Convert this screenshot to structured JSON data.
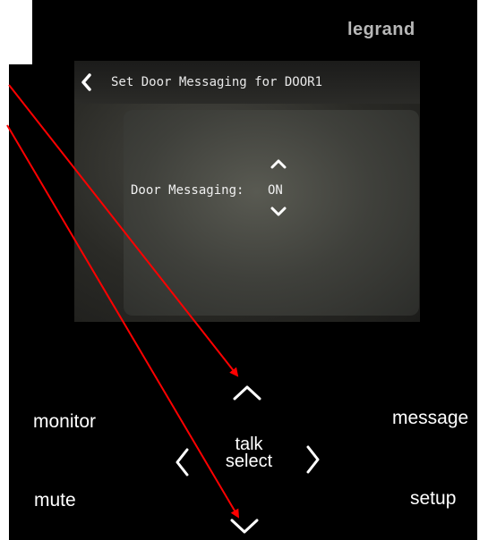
{
  "brand": {
    "name": "legrand"
  },
  "screen": {
    "title": "Set Door Messaging for DOOR1",
    "field_label": "Door Messaging:",
    "field_value": "ON"
  },
  "buttons": {
    "monitor": "monitor",
    "message": "message",
    "mute": "mute",
    "setup": "setup",
    "talk_line1": "talk",
    "talk_line2": "select"
  },
  "icons": {
    "back": "chevron-left-icon",
    "value_up": "chevron-up-icon",
    "value_down": "chevron-down-icon",
    "nav_up": "chevron-up-icon",
    "nav_down": "chevron-down-icon",
    "nav_left": "chevron-left-icon",
    "nav_right": "chevron-right-icon"
  },
  "colors": {
    "panel": "#000000",
    "brand": "#b8b8b8",
    "screen_text": "#f0f0f0",
    "button_text": "#ffffff",
    "annotation_arrow": "#ff0000"
  }
}
